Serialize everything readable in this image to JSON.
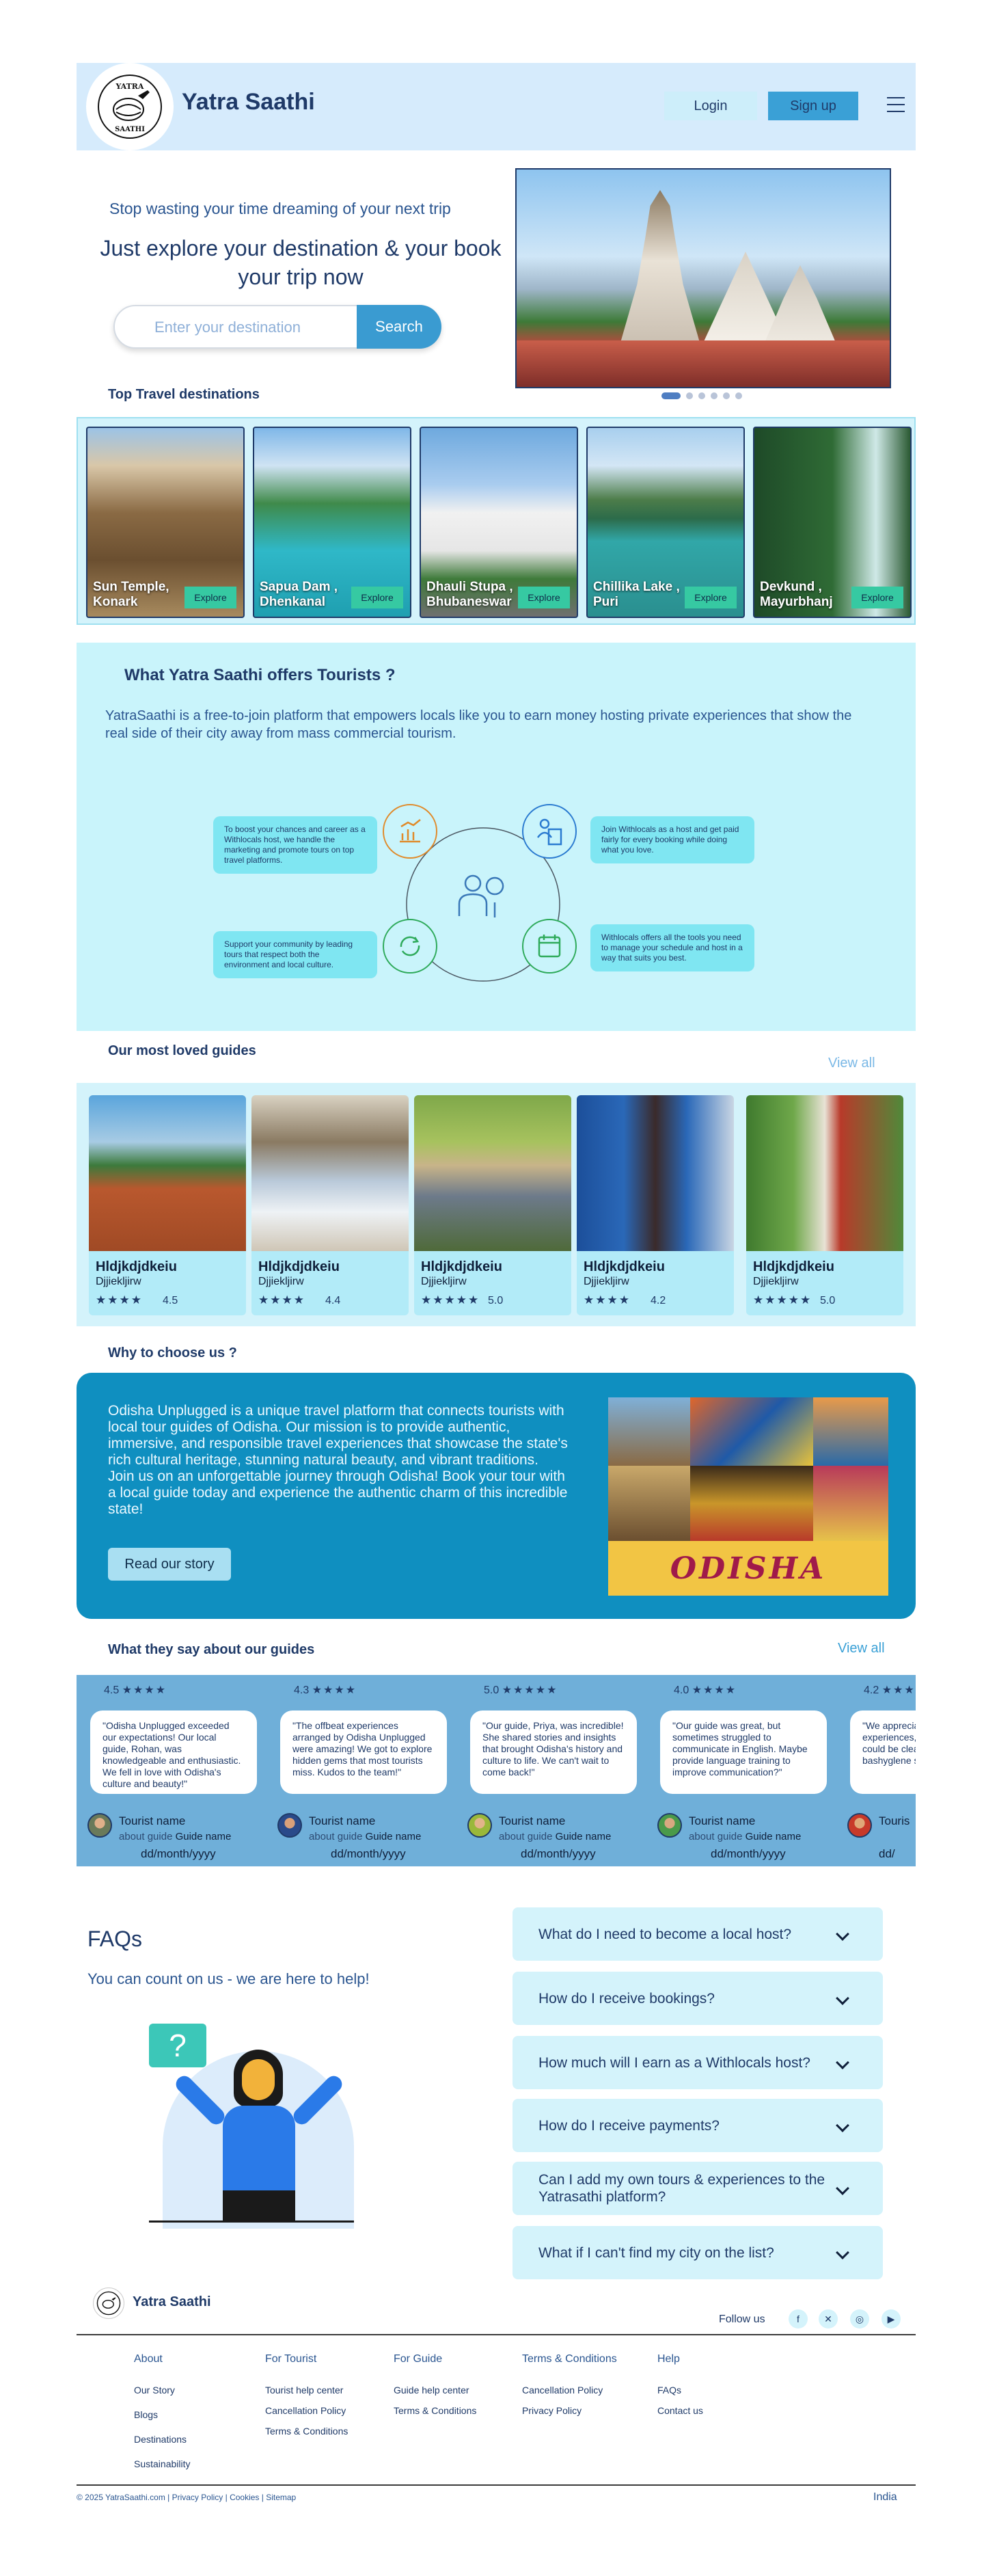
{
  "header": {
    "brand": "Yatra Saathi",
    "logo_text_top": "YATRA",
    "logo_text_bottom": "SAATHI",
    "login": "Login",
    "signup": "Sign up"
  },
  "hero": {
    "tagline": "Stop wasting your time dreaming of your next trip",
    "title": "Just explore your destination & your book your trip now",
    "search_placeholder": "Enter your destination",
    "search_button": "Search",
    "carousel_count": 6,
    "carousel_active": 1
  },
  "destinations": {
    "title": "Top Travel destinations",
    "explore": "Explore",
    "items": [
      {
        "name": "Sun Temple, Konark"
      },
      {
        "name": "Sapua Dam , Dhenkanal"
      },
      {
        "name": "Dhauli Stupa , Bhubaneswar"
      },
      {
        "name": "Chillika Lake , Puri"
      },
      {
        "name": "Devkund , Mayurbhanj"
      }
    ]
  },
  "offers": {
    "title": "What Yatra Saathi offers Tourists ?",
    "description": "YatraSaathi is a free-to-join platform that empowers locals like you to earn money hosting private experiences that show the real side of their city away from mass commercial tourism.",
    "points": [
      "To boost your chances and career as a Withlocals host, we handle the marketing and promote tours on top travel platforms.",
      "Join Withlocals as a host and get paid fairly for every booking while doing what you love.",
      "Support your community by leading tours that respect both the environment and local culture.",
      "Withlocals offers all the tools you need to manage your schedule and host in a way that suits you best."
    ]
  },
  "guides": {
    "title": "Our most loved guides",
    "view_all": "View all",
    "items": [
      {
        "name": "Hldjkdjdkeiu",
        "sub": "Djjiekljirw",
        "stars": "★★★★",
        "rating": "4.5"
      },
      {
        "name": "Hldjkdjdkeiu",
        "sub": "Djjiekljirw",
        "stars": "★★★★",
        "rating": "4.4"
      },
      {
        "name": "Hldjkdjdkeiu",
        "sub": "Djjiekljirw",
        "stars": "★★★★★",
        "rating": "5.0"
      },
      {
        "name": "Hldjkdjdkeiu",
        "sub": "Djjiekljirw",
        "stars": "★★★★",
        "rating": "4.2"
      },
      {
        "name": "Hldjkdjdkeiu",
        "sub": "Djjiekljirw",
        "stars": "★★★★★",
        "rating": "5.0"
      }
    ]
  },
  "why": {
    "title": "Why to choose us ?",
    "text1": "Odisha Unplugged is a unique travel platform that connects tourists with local tour guides of Odisha. Our mission is to provide authentic, immersive, and responsible travel experiences that showcase the state's rich cultural heritage, stunning natural beauty, and vibrant traditions.",
    "text2": "Join us on an unforgettable journey through Odisha! Book your tour with a local guide today and experience the authentic charm of this incredible state!",
    "button": "Read our story",
    "image_word": "ODISHA"
  },
  "testimonials": {
    "title": "What they say about our guides",
    "view_all": "View all",
    "items": [
      {
        "rating": "4.5",
        "stars": "★★★★",
        "quote": "\"Odisha Unplugged exceeded our expectations! Our local guide, Rohan, was knowledgeable and enthusiastic. We fell in love with Odisha's culture and beauty!\"",
        "name": "Tourist name",
        "about": "about guide",
        "guide": "Guide name",
        "date": "dd/month/yyyy"
      },
      {
        "rating": "4.3",
        "stars": "★★★★",
        "quote": "\"The offbeat experiences arranged by Odisha Unplugged were amazing! We got to explore hidden gems that most tourists miss. Kudos to the team!\"",
        "name": "Tourist name",
        "about": "about guide",
        "guide": "Guide name",
        "date": "dd/month/yyyy"
      },
      {
        "rating": "5.0",
        "stars": "★★★★★",
        "quote": "\"Our guide, Priya, was incredible! She shared stories and insights that brought Odisha's history and culture to life. We can't wait to come back!\"",
        "name": "Tourist name",
        "about": "about guide",
        "guide": "Guide name",
        "date": "dd/month/yyyy"
      },
      {
        "rating": "4.0",
        "stars": "★★★★",
        "quote": "\"Our guide was great, but sometimes struggled to communicate in English. Maybe provide language training to improve communication?\"",
        "name": "Tourist name",
        "about": "about guide",
        "guide": "Guide name",
        "date": "dd/month/yyyy"
      },
      {
        "rating": "4.2",
        "stars": "★★★★",
        "quote": "\"We appreciated the f experiences, but so t restaurants could be cleaner. Please bashyglene standar",
        "name": "Touris",
        "about": "",
        "guide": "",
        "date": "dd/"
      }
    ]
  },
  "faq": {
    "title": "FAQs",
    "subtitle": "You can count on us - we are here to help!",
    "questions": [
      "What do I need to become a local host?",
      "How do I receive bookings?",
      "How much will I earn as a Withlocals host?",
      "How do I receive payments?",
      "Can I add my own tours & experiences to the Yatrasathi platform?",
      "What if I can't find my city on the list?"
    ]
  },
  "footer": {
    "brand": "Yatra Saathi",
    "follow": "Follow us",
    "columns": [
      {
        "head": "About",
        "links": [
          "Our Story",
          "Blogs",
          "Destinations",
          "Sustainability"
        ]
      },
      {
        "head": "For Tourist",
        "links": [
          "Tourist help center",
          "Cancellation Policy",
          "Terms & Conditions"
        ]
      },
      {
        "head": "For Guide",
        "links": [
          "Guide help center",
          "Terms & Conditions"
        ]
      },
      {
        "head": "Terms & Conditions",
        "links": [
          "Cancellation Policy",
          "Privacy Policy"
        ]
      },
      {
        "head": "Help",
        "links": [
          "FAQs",
          "Contact us"
        ]
      }
    ],
    "copyright": "© 2025 YatraSaathi.com | Privacy Policy | Cookies | Sitemap",
    "country": "India"
  }
}
